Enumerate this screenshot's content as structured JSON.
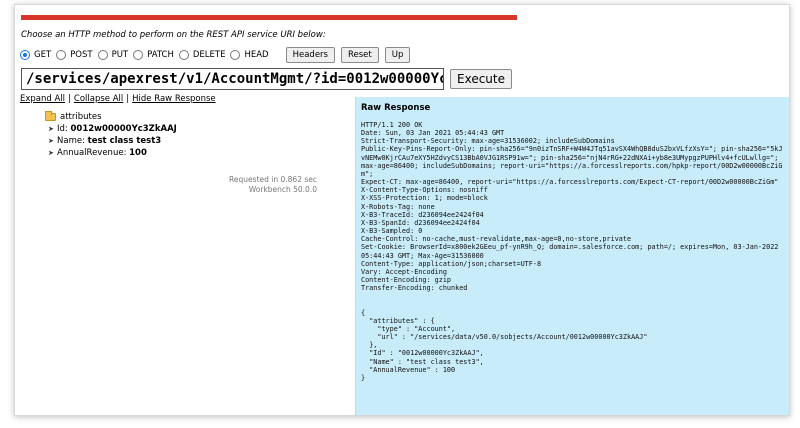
{
  "instruction": "Choose an HTTP method to perform on the REST API service URI below:",
  "methods": [
    {
      "label": "GET",
      "selected": true
    },
    {
      "label": "POST",
      "selected": false
    },
    {
      "label": "PUT",
      "selected": false
    },
    {
      "label": "PATCH",
      "selected": false
    },
    {
      "label": "DELETE",
      "selected": false
    },
    {
      "label": "HEAD",
      "selected": false
    }
  ],
  "buttons": {
    "headers": "Headers",
    "reset": "Reset",
    "up": "Up",
    "execute": "Execute"
  },
  "url": "/services/apexrest/v1/AccountMgmt/?id=0012w00000Yc3ZkAAJ",
  "links": {
    "expand": "Expand All",
    "collapse": "Collapse All",
    "raw": "Hide Raw Response",
    "sep": "|"
  },
  "tree": {
    "folder": "attributes",
    "items": [
      {
        "key": "Id:",
        "value": "0012w00000Yc3ZkAAJ"
      },
      {
        "key": "Name:",
        "value": "test class test3"
      },
      {
        "key": "AnnualRevenue:",
        "value": "100"
      }
    ]
  },
  "timing": {
    "requested": "Requested in 0.862 sec",
    "version": "Workbench 50.0.0"
  },
  "raw_response": {
    "title": "Raw Response",
    "body": "HTTP/1.1 200 OK\nDate: Sun, 03 Jan 2021 05:44:43 GMT\nStrict-Transport-Security: max-age=31536002; includeSubDomains\nPublic-Key-Pins-Report-Only: pin-sha256=\"9n0izTnSRF+W4W4JTq51avSX4WhQB8duS2bxVLfzXsY=\"; pin-sha256=\"5kJvNEMw0KjrCAu7eXY5HZdvyCS13BbA0VJG1RSP91w=\"; pin-sha256=\"njN4rRG+22dNXAi+yb8e3UMypgzPUPHlv4+fcULwllg=\"; max-age=86400; includeSubDomains; report-uri=\"https://a.forcesslreports.com/hpkp-report/00D2w00000BcZiGm\";\nExpect-CT: max-age=86400, report-uri=\"https://a.forcesslreports.com/Expect-CT-report/00D2w00000BcZiGm\"\nX-Content-Type-Options: nosniff\nX-XSS-Protection: 1; mode=block\nX-Robots-Tag: none\nX-B3-TraceId: d236094ee2424f04\nX-B3-SpanId: d236094ee2424f04\nX-B3-Sampled: 0\nCache-Control: no-cache,must-revalidate,max-age=0,no-store,private\nSet-Cookie: BrowserId=x800ek2GEeu_pf-ynR9h_Q; domain=.salesforce.com; path=/; expires=Mon, 03-Jan-2022 05:44:43 GMT; Max-Age=31536000\nContent-Type: application/json;charset=UTF-8\nVary: Accept-Encoding\nContent-Encoding: gzip\nTransfer-Encoding: chunked\n\n\n{\n  \"attributes\" : {\n    \"type\" : \"Account\",\n    \"url\" : \"/services/data/v50.0/sobjects/Account/0012w00000Yc3ZkAAJ\"\n  },\n  \"Id\" : \"0012w00000Yc3ZkAAJ\",\n  \"Name\" : \"test class test3\",\n  \"AnnualRevenue\" : 100\n}"
  }
}
